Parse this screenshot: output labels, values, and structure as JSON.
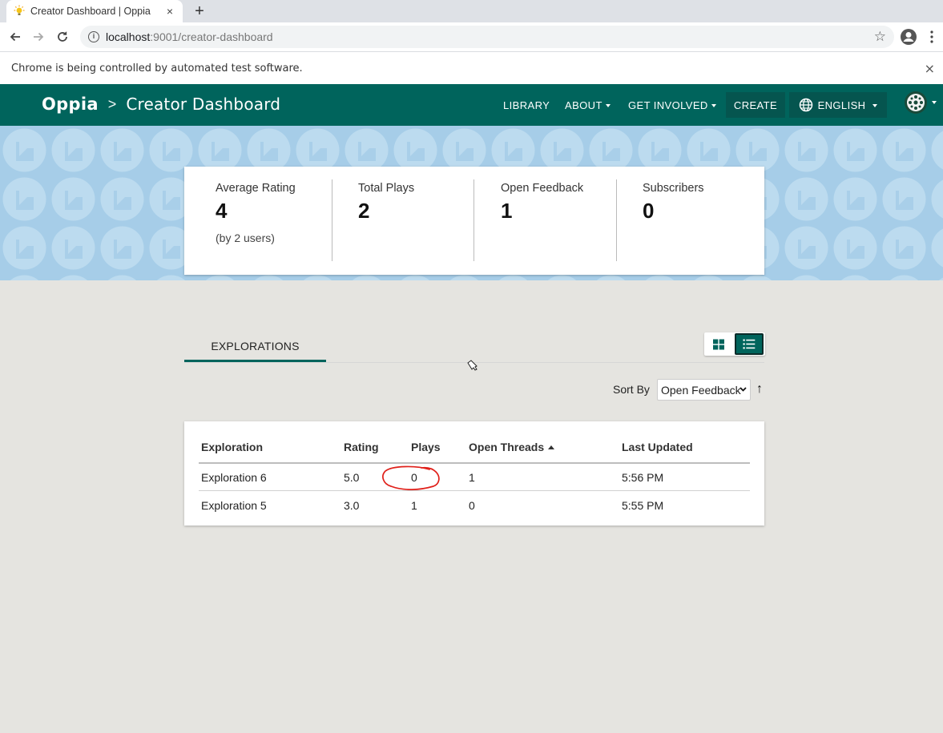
{
  "browser": {
    "tab_title": "Creator Dashboard | Oppia",
    "tab_close": "×",
    "new_tab": "+",
    "url_host": "localhost",
    "url_path": ":9001/creator-dashboard",
    "infobar_text": "Chrome is being controlled by automated test software.",
    "infobar_close": "×"
  },
  "navbar": {
    "logo": "Oppia",
    "separator": ">",
    "page_title": "Creator Dashboard",
    "library": "LIBRARY",
    "about": "ABOUT",
    "get_involved": "GET INVOLVED",
    "create": "CREATE",
    "language": "ENGLISH"
  },
  "stats": [
    {
      "label": "Average Rating",
      "value": "4",
      "sub": "(by 2 users)"
    },
    {
      "label": "Total Plays",
      "value": "2",
      "sub": ""
    },
    {
      "label": "Open Feedback",
      "value": "1",
      "sub": ""
    },
    {
      "label": "Subscribers",
      "value": "0",
      "sub": ""
    }
  ],
  "tabs": {
    "explorations": "EXPLORATIONS"
  },
  "sort": {
    "label": "Sort By",
    "selected": "Open Feedback",
    "direction_icon": "↑"
  },
  "table": {
    "headers": [
      "Exploration",
      "Rating",
      "Plays",
      "Open Threads",
      "Last Updated"
    ],
    "rows": [
      [
        "Exploration 6",
        "5.0",
        "0",
        "1",
        "5:56 PM"
      ],
      [
        "Exploration 5",
        "3.0",
        "1",
        "0",
        "5:55 PM"
      ]
    ]
  },
  "colors": {
    "navbar": "#00645c",
    "banner": "#a6cde8",
    "page_bg": "#e5e4e0",
    "annotation": "#e0201a"
  },
  "icons": {
    "favicon": "lightbulb-icon",
    "info": "info-icon",
    "star": "bookmark-star-icon",
    "language": "globe-icon",
    "grid_view": "grid-view-icon",
    "list_view": "list-view-icon"
  }
}
